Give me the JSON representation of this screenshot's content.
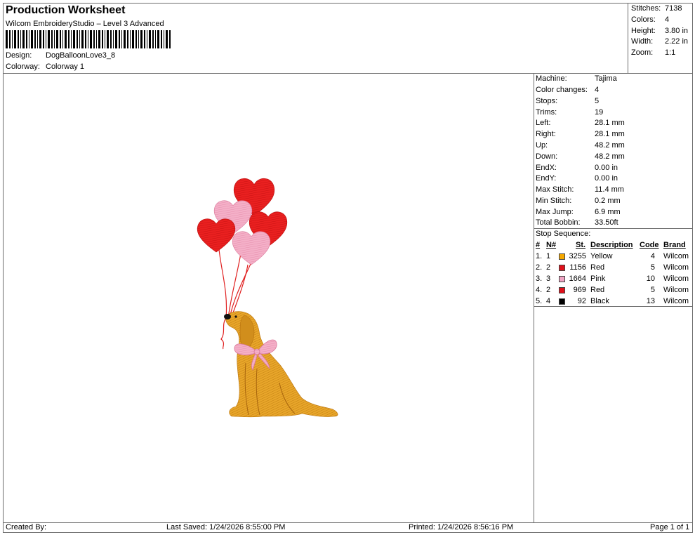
{
  "header": {
    "title": "Production Worksheet",
    "software": "Wilcom EmbroideryStudio – Level 3 Advanced",
    "design_label": "Design:",
    "design_value": "DogBalloonLove3_8",
    "colorway_label": "Colorway:",
    "colorway_value": "Colorway 1"
  },
  "stats": [
    {
      "label": "Stitches:",
      "value": "7138"
    },
    {
      "label": "Colors:",
      "value": "4"
    },
    {
      "label": "Height:",
      "value": "3.80 in"
    },
    {
      "label": "Width:",
      "value": "2.22 in"
    },
    {
      "label": "Zoom:",
      "value": "1:1"
    }
  ],
  "machine_info": [
    {
      "label": "Machine:",
      "value": "Tajima"
    },
    {
      "label": "Color changes:",
      "value": "4"
    },
    {
      "label": "Stops:",
      "value": "5"
    },
    {
      "label": "Trims:",
      "value": "19"
    },
    {
      "label": "Left:",
      "value": "28.1 mm"
    },
    {
      "label": "Right:",
      "value": "28.1 mm"
    },
    {
      "label": "Up:",
      "value": "48.2 mm"
    },
    {
      "label": "Down:",
      "value": "48.2 mm"
    },
    {
      "label": "EndX:",
      "value": "0.00 in"
    },
    {
      "label": "EndY:",
      "value": "0.00 in"
    },
    {
      "label": "Max Stitch:",
      "value": "11.4 mm"
    },
    {
      "label": "Min Stitch:",
      "value": "0.2 mm"
    },
    {
      "label": "Max Jump:",
      "value": "6.9 mm"
    },
    {
      "label": "Total Bobbin:",
      "value": "33.50ft"
    }
  ],
  "stop_sequence": {
    "title": "Stop Sequence:",
    "columns": {
      "index": "#",
      "needle": "N#",
      "stitches": "St.",
      "description": "Description",
      "code": "Code",
      "brand": "Brand"
    },
    "rows": [
      {
        "index": "1.",
        "needle": "1",
        "color": "#f5a800",
        "stitches": "3255",
        "description": "Yellow",
        "code": "4",
        "brand": "Wilcom"
      },
      {
        "index": "2.",
        "needle": "2",
        "color": "#e0101a",
        "stitches": "1156",
        "description": "Red",
        "code": "5",
        "brand": "Wilcom"
      },
      {
        "index": "3.",
        "needle": "3",
        "color": "#f0a4c4",
        "stitches": "1664",
        "description": "Pink",
        "code": "10",
        "brand": "Wilcom"
      },
      {
        "index": "4.",
        "needle": "2",
        "color": "#e0101a",
        "stitches": "969",
        "description": "Red",
        "code": "5",
        "brand": "Wilcom"
      },
      {
        "index": "5.",
        "needle": "4",
        "color": "#000000",
        "stitches": "92",
        "description": "Black",
        "code": "13",
        "brand": "Wilcom"
      }
    ]
  },
  "footer": {
    "created_by": "Created By:",
    "last_saved": "Last Saved: 1/24/2026 8:55:00 PM",
    "printed": "Printed: 1/24/2026 8:56:16 PM",
    "page": "Page 1 of 1"
  }
}
